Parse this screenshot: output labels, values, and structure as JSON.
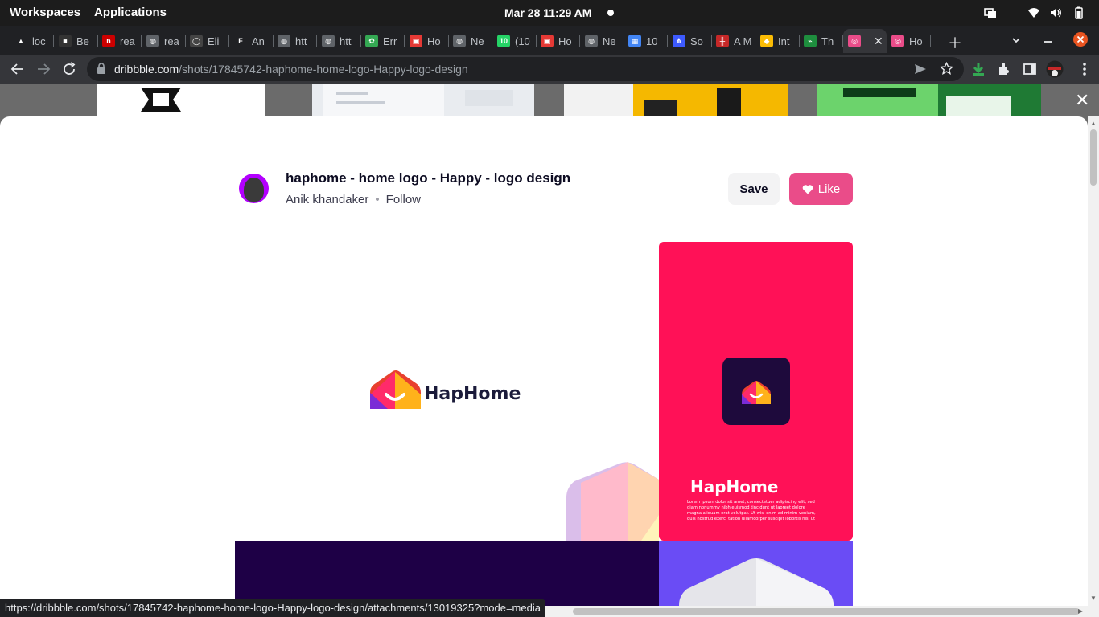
{
  "system_bar": {
    "workspaces_label": "Workspaces",
    "applications_label": "Applications",
    "clock": "Mar 28  11:29 AM"
  },
  "browser": {
    "tabs": [
      {
        "label": "loc",
        "color": "#202124",
        "glyph": "▲"
      },
      {
        "label": "Be",
        "color": "#333333",
        "glyph": "■"
      },
      {
        "label": "rea",
        "color": "#cc0000",
        "glyph": "n"
      },
      {
        "label": "rea",
        "color": "#5f6368",
        "glyph": "◍"
      },
      {
        "label": "Eli",
        "color": "#444444",
        "glyph": "◯"
      },
      {
        "label": "An",
        "color": "#202124",
        "glyph": "F"
      },
      {
        "label": "htt",
        "color": "#5f6368",
        "glyph": "◍"
      },
      {
        "label": "htt",
        "color": "#5f6368",
        "glyph": "◍"
      },
      {
        "label": "Err",
        "color": "#34a853",
        "glyph": "✿"
      },
      {
        "label": "Ho",
        "color": "#e53935",
        "glyph": "▣"
      },
      {
        "label": "Ne",
        "color": "#5f6368",
        "glyph": "◍"
      },
      {
        "label": "(10",
        "color": "#25d366",
        "glyph": "10"
      },
      {
        "label": "Ho",
        "color": "#e53935",
        "glyph": "▣"
      },
      {
        "label": "Ne",
        "color": "#5f6368",
        "glyph": "◍"
      },
      {
        "label": "10",
        "color": "#4285f4",
        "glyph": "▦"
      },
      {
        "label": "So",
        "color": "#3d5afe",
        "glyph": "⋔"
      },
      {
        "label": "A M",
        "color": "#c62828",
        "glyph": "╫"
      },
      {
        "label": "Int",
        "color": "#fbbc04",
        "glyph": "◆"
      },
      {
        "label": "Th",
        "color": "#1e8e3e",
        "glyph": "⌁"
      },
      {
        "label": "",
        "color": "#ea4c89",
        "glyph": "◎",
        "active": true
      },
      {
        "label": "Ho",
        "color": "#ea4c89",
        "glyph": "◎"
      }
    ],
    "address": {
      "host": "dribbble.com",
      "path": "/shots/17845742-haphome-home-logo-Happy-logo-design"
    },
    "status_url": "https://dribbble.com/shots/17845742-haphome-home-logo-Happy-logo-design/attachments/13019325?mode=media"
  },
  "shot": {
    "title": "haphome - home logo - Happy - logo design",
    "author": "Anik khandaker",
    "follow_label": "Follow",
    "save_label": "Save",
    "like_label": "Like",
    "art": {
      "brand_name": "HapHome",
      "card_brand_name": "HapHome",
      "card_text": [
        "Lorem ipsum dolor sit amet, consectetuer adipiscing elit, sed",
        "diam nonummy nibh euismod tincidunt ut laoreet dolore",
        "magna aliquam erat volutpat. Ut wisi enim ad minim veniam,",
        "quis nostrud exerci tation ullamcorper suscipit lobortis nisl ut"
      ],
      "colors": {
        "pink_panel": "#ff1157",
        "navy_panel": "#1e0046",
        "purple_panel": "#6a4cf5",
        "icon_bg": "#1e0a3c"
      }
    }
  }
}
